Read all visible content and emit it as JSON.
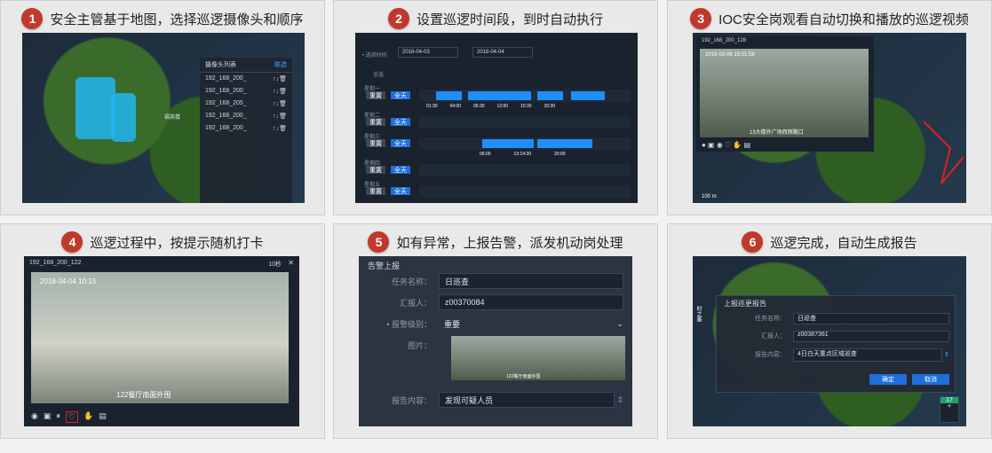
{
  "steps": [
    {
      "n": "1",
      "title": "安全主管基于地图，选择巡逻摄像头和顺序"
    },
    {
      "n": "2",
      "title": "设置巡逻时间段，到时自动执行"
    },
    {
      "n": "3",
      "title": "IOC安全岗观看自动切换和播放的巡逻视频"
    },
    {
      "n": "4",
      "title": "巡逻过程中，按提示随机打卡"
    },
    {
      "n": "5",
      "title": "如有异常，上报告警，派发机动岗处理"
    },
    {
      "n": "6",
      "title": "巡逻完成，自动生成报告"
    }
  ],
  "s1": {
    "panel_title": "摄像头列表",
    "panel_action": "联选",
    "cams": [
      "192_168_200_",
      "192_168_200_",
      "192_168_205_",
      "192_168_200_",
      "192_168_200_"
    ],
    "map_label": "福英楼"
  },
  "s2": {
    "date_label": "• 选择时间",
    "date_start": "2018-04-03",
    "date_end": "2018-04-04",
    "all_label": "全选",
    "reset": "重置",
    "full_day": "全天",
    "days": [
      "星期一",
      "星期二",
      "星期三",
      "星期四",
      "星期五"
    ],
    "times1": [
      "01:30",
      "04:00",
      "05:30",
      "12:00",
      "15:30",
      "20:30"
    ],
    "times3": [
      "06:00",
      "13:14:30",
      "20:00"
    ]
  },
  "s3": {
    "cam_title": "192_168_200_128",
    "overlay_time": "2018-03-06 15:01:58",
    "caption": "13大楼外广场西侧路口",
    "scale": "100 m"
  },
  "s4": {
    "cam_title": "192_168_200_122",
    "timer": "10秒",
    "overlay_time": "2018-04-04 10:15",
    "caption": "122餐厅南面外围"
  },
  "s5": {
    "title": "告警上报",
    "task_label": "任务名称：",
    "task_value": "日巡查",
    "reporter_label": "汇报人：",
    "reporter_value": "z00370084",
    "level_label": "• 报警级别：",
    "level_value": "重要",
    "image_label": "图片：",
    "img_caption": "122餐厅南面外围",
    "content_label": "报告内容：",
    "content_value": "发现可疑人员"
  },
  "s6": {
    "title": "上报巡更报告",
    "task_label": "任务名称：",
    "task_value": "日巡查",
    "reporter_label": "汇报人：",
    "reporter_value": "z00387361",
    "content_label": "报告内容：",
    "content_value": "4日白天重点区域巡查",
    "ok": "确定",
    "cancel": "取消",
    "zoom": "17",
    "side_label": "时之墨"
  }
}
